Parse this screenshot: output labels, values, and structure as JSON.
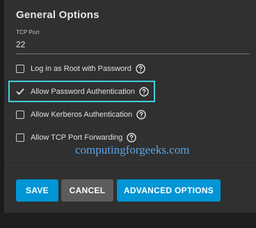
{
  "dialog": {
    "title": "General Options",
    "tcp_port": {
      "label": "TCP Port",
      "value": "22"
    },
    "options": [
      {
        "label": "Log in as Root with Password",
        "checked": false
      },
      {
        "label": "Allow Password Authentication",
        "checked": true
      },
      {
        "label": "Allow Kerberos Authentication",
        "checked": false
      },
      {
        "label": "Allow TCP Port Forwarding",
        "checked": false
      }
    ],
    "buttons": {
      "save": "SAVE",
      "cancel": "CANCEL",
      "advanced": "ADVANCED OPTIONS"
    }
  },
  "watermark": "computingforgeeks.com",
  "colors": {
    "accent": "#0095d5",
    "highlight": "#3fd1dc",
    "watermark": "#5aa6ea",
    "cancel": "#5c5c5c"
  },
  "icons": {
    "help": "help-circle-icon",
    "check": "checkmark-icon"
  }
}
